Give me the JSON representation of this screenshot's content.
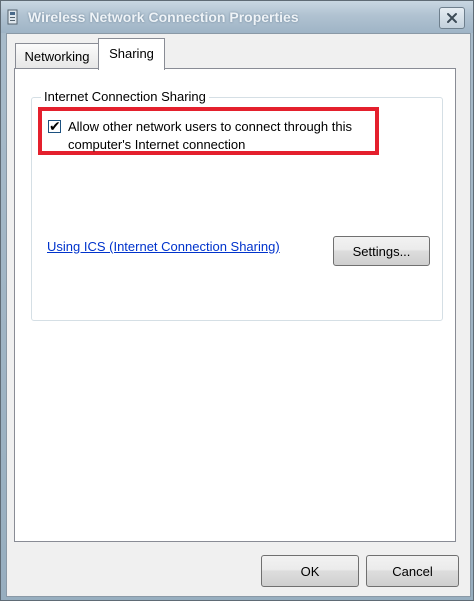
{
  "window": {
    "title": "Wireless Network Connection Properties",
    "close_icon": "close-icon"
  },
  "tabs": [
    {
      "label": "Networking",
      "selected": false
    },
    {
      "label": "Sharing",
      "selected": true
    }
  ],
  "sharing": {
    "group_label": "Internet Connection Sharing",
    "allow_checkbox": {
      "label": "Allow other network users to connect through this computer's Internet connection",
      "checked": true
    },
    "link": "Using ICS (Internet Connection Sharing)",
    "settings_button": "Settings..."
  },
  "footer": {
    "ok_label": "OK",
    "cancel_label": "Cancel"
  },
  "colors": {
    "highlight": "#e4202d",
    "link": "#0033cc"
  }
}
